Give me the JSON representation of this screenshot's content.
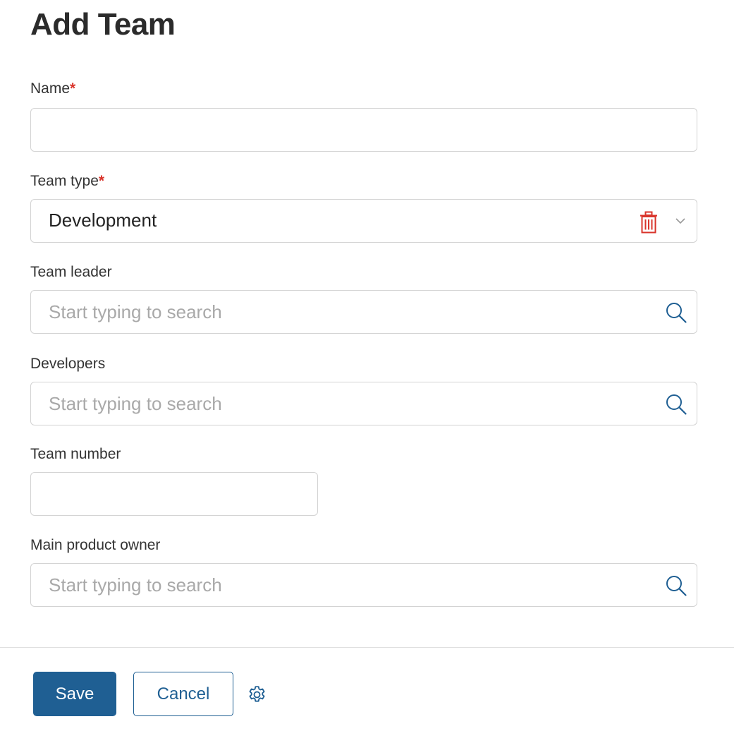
{
  "form": {
    "title": "Add Team",
    "required_marker": "*",
    "fields": {
      "name": {
        "label": "Name",
        "value": "",
        "placeholder": ""
      },
      "team_type": {
        "label": "Team type",
        "value": "Development"
      },
      "team_leader": {
        "label": "Team leader",
        "value": "",
        "placeholder": "Start typing to search"
      },
      "developers": {
        "label": "Developers",
        "value": "",
        "placeholder": "Start typing to search"
      },
      "team_number": {
        "label": "Team number",
        "value": "",
        "placeholder": ""
      },
      "main_product_owner": {
        "label": "Main product owner",
        "value": "",
        "placeholder": "Start typing to search"
      }
    }
  },
  "footer": {
    "save_label": "Save",
    "cancel_label": "Cancel"
  },
  "icons": {
    "delete": "trash-icon",
    "dropdown": "chevron-down-icon",
    "search": "search-icon",
    "settings": "gear-icon"
  },
  "colors": {
    "accent": "#1f5f93",
    "required": "#d9342b",
    "delete": "#d9342b",
    "border": "#d3d3d3",
    "placeholder": "#a9a9a9"
  }
}
